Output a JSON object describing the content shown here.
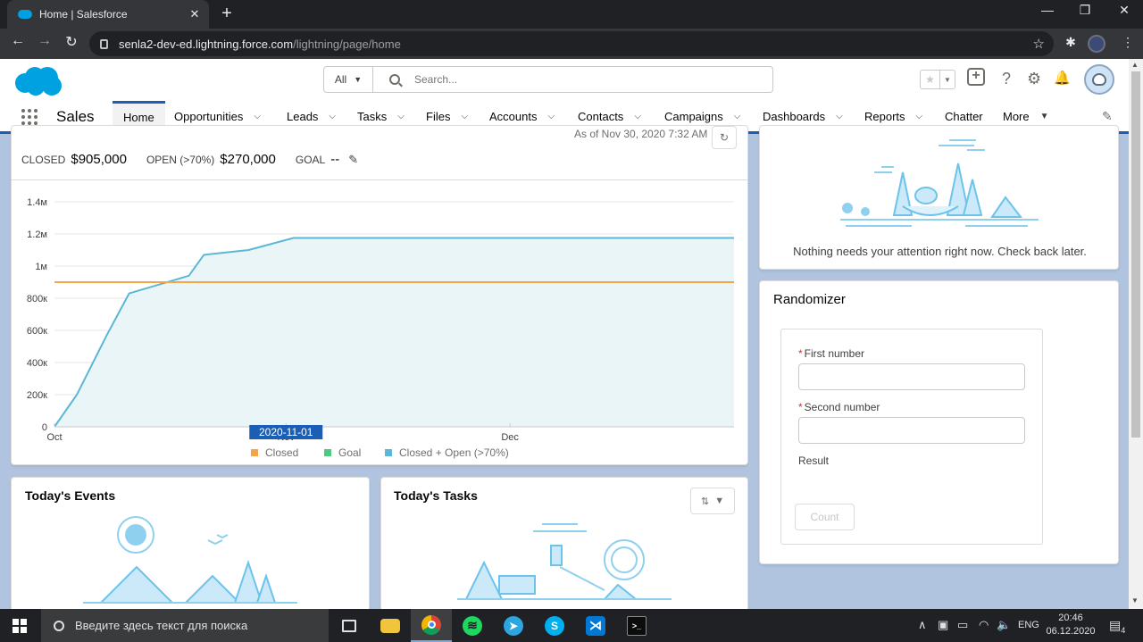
{
  "browser": {
    "tab_title": "Home | Salesforce",
    "tab_close": "✕",
    "new_tab": "+",
    "url_host": "senla2-dev-ed.lightning.force.com",
    "url_path": "/lightning/page/home",
    "minimize": "—",
    "restore": "❐",
    "close": "✕"
  },
  "sf_header": {
    "search_scope": "All",
    "search_placeholder": "Search..."
  },
  "nav": {
    "app_name": "Sales",
    "items": [
      {
        "label": "Home",
        "active": true
      },
      {
        "label": "Opportunities"
      },
      {
        "label": "Leads"
      },
      {
        "label": "Tasks"
      },
      {
        "label": "Files"
      },
      {
        "label": "Accounts"
      },
      {
        "label": "Contacts"
      },
      {
        "label": "Campaigns"
      },
      {
        "label": "Dashboards"
      },
      {
        "label": "Reports"
      },
      {
        "label": "Chatter"
      },
      {
        "label": "More"
      }
    ]
  },
  "performance": {
    "as_of": "As of Nov 30, 2020 7:32 AM",
    "closed_label": "CLOSED",
    "closed_value": "$905,000",
    "open_label": "OPEN (>70%)",
    "open_value": "$270,000",
    "goal_label": "GOAL",
    "goal_value": "--"
  },
  "chart_data": {
    "type": "area",
    "y_ticks": [
      "1.4м",
      "1.2м",
      "1м",
      "800к",
      "600к",
      "400к",
      "200к",
      "0"
    ],
    "ylim": [
      0,
      1400000
    ],
    "x_ticks": [
      "Oct",
      "Nov",
      "Dec"
    ],
    "tooltip_label": "2020-11-01",
    "legend": [
      "Closed",
      "Goal",
      "Closed + Open (>70%)"
    ],
    "legend_colors": [
      "#f5a44b",
      "#4bca81",
      "#5cb7d5"
    ],
    "series": [
      {
        "name": "Closed + Open (>70%)",
        "color": "#5cb7d5",
        "points": [
          [
            "2020-10-01",
            0
          ],
          [
            "2020-10-04",
            200000
          ],
          [
            "2020-10-08",
            570000
          ],
          [
            "2020-10-11",
            830000
          ],
          [
            "2020-10-19",
            940000
          ],
          [
            "2020-10-21",
            1070000
          ],
          [
            "2020-10-27",
            1100000
          ],
          [
            "2020-11-02",
            1175000
          ],
          [
            "2020-12-31",
            1175000
          ]
        ]
      },
      {
        "name": "Goal",
        "color": "#f5a44b",
        "points": [
          [
            "2020-10-01",
            900000
          ],
          [
            "2020-12-31",
            900000
          ]
        ]
      }
    ]
  },
  "assistant": {
    "message": "Nothing needs your attention right now. Check back later."
  },
  "randomizer": {
    "title": "Randomizer",
    "first_label": "First number",
    "second_label": "Second number",
    "required_mark": "*",
    "result_label": "Result",
    "count_button": "Count"
  },
  "events": {
    "title": "Today's Events"
  },
  "tasks": {
    "title": "Today's Tasks"
  },
  "taskbar": {
    "search_placeholder": "Введите здесь текст для поиска",
    "language": "ENG",
    "time": "20:46",
    "date": "06.12.2020",
    "notifications": "4"
  }
}
